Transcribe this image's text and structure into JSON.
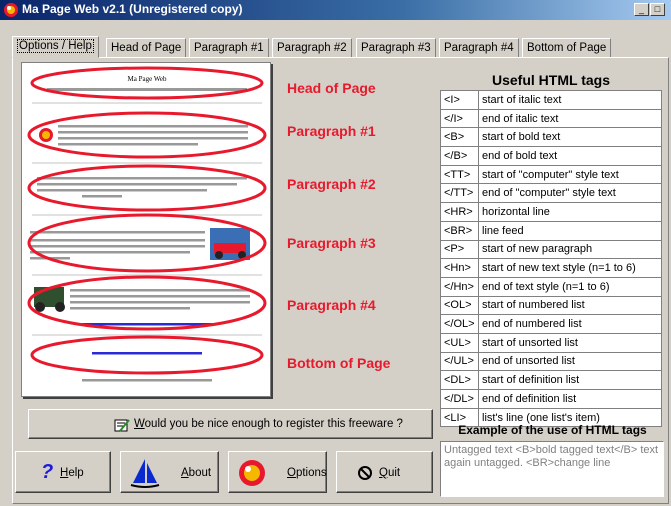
{
  "window": {
    "title": "Ma Page Web v2.1 (Unregistered copy)",
    "minimize": "_",
    "maximize": "□",
    "close": "×"
  },
  "tabs": [
    {
      "label": "Options / Help",
      "active": true
    },
    {
      "label": "Head of Page"
    },
    {
      "label": "Paragraph #1"
    },
    {
      "label": "Paragraph #2"
    },
    {
      "label": "Paragraph #3"
    },
    {
      "label": "Paragraph #4"
    },
    {
      "label": "Bottom of Page"
    }
  ],
  "preview": {
    "page_title": "Ma Page Web"
  },
  "sections": {
    "head": "Head of Page",
    "p1": "Paragraph #1",
    "p2": "Paragraph #2",
    "p3": "Paragraph #3",
    "p4": "Paragraph #4",
    "bottom": "Bottom of Page"
  },
  "useful_tags": {
    "title": "Useful HTML tags",
    "rows": [
      {
        "tag": "<I>",
        "desc": "start of italic text"
      },
      {
        "tag": "</I>",
        "desc": "end of italic text"
      },
      {
        "tag": "<B>",
        "desc": "start of bold text"
      },
      {
        "tag": "</B>",
        "desc": "end of bold text"
      },
      {
        "tag": "<TT>",
        "desc": "start of \"computer\" style text"
      },
      {
        "tag": "</TT>",
        "desc": "end of \"computer\" style text"
      },
      {
        "tag": "<HR>",
        "desc": "horizontal line"
      },
      {
        "tag": "<BR>",
        "desc": "line feed"
      },
      {
        "tag": "<P>",
        "desc": "start of new paragraph"
      },
      {
        "tag": "<Hn>",
        "desc": "start of new text style (n=1 to 6)"
      },
      {
        "tag": "</Hn>",
        "desc": "end of text style (n=1 to 6)"
      },
      {
        "tag": "<OL>",
        "desc": "start of numbered list"
      },
      {
        "tag": "</OL>",
        "desc": "end of numbered list"
      },
      {
        "tag": "<UL>",
        "desc": "start of unsorted list"
      },
      {
        "tag": "</UL>",
        "desc": "end of unsorted list"
      },
      {
        "tag": "<DL>",
        "desc": "start of definition list"
      },
      {
        "tag": "</DL>",
        "desc": "end of definition list"
      },
      {
        "tag": "<LI>",
        "desc": "list's line (one list's item)"
      }
    ]
  },
  "example": {
    "title": "Example of the use of HTML tags",
    "text": "Untagged text <B>bold tagged text</B> text again untagged. <BR>change line"
  },
  "register_button": {
    "label_prefix": "",
    "label_underline": "W",
    "label_rest": "ould you be nice enough to register this freeware ?"
  },
  "buttons": {
    "help": {
      "u": "H",
      "rest": "elp"
    },
    "about": {
      "u": "A",
      "rest": "bout"
    },
    "options": {
      "u": "O",
      "rest": "ptions"
    },
    "quit": {
      "u": "Q",
      "rest": "uit"
    }
  },
  "colors": {
    "title_bar": "#0a246a",
    "section_red": "#e8192c",
    "face": "#d4d0c8"
  }
}
